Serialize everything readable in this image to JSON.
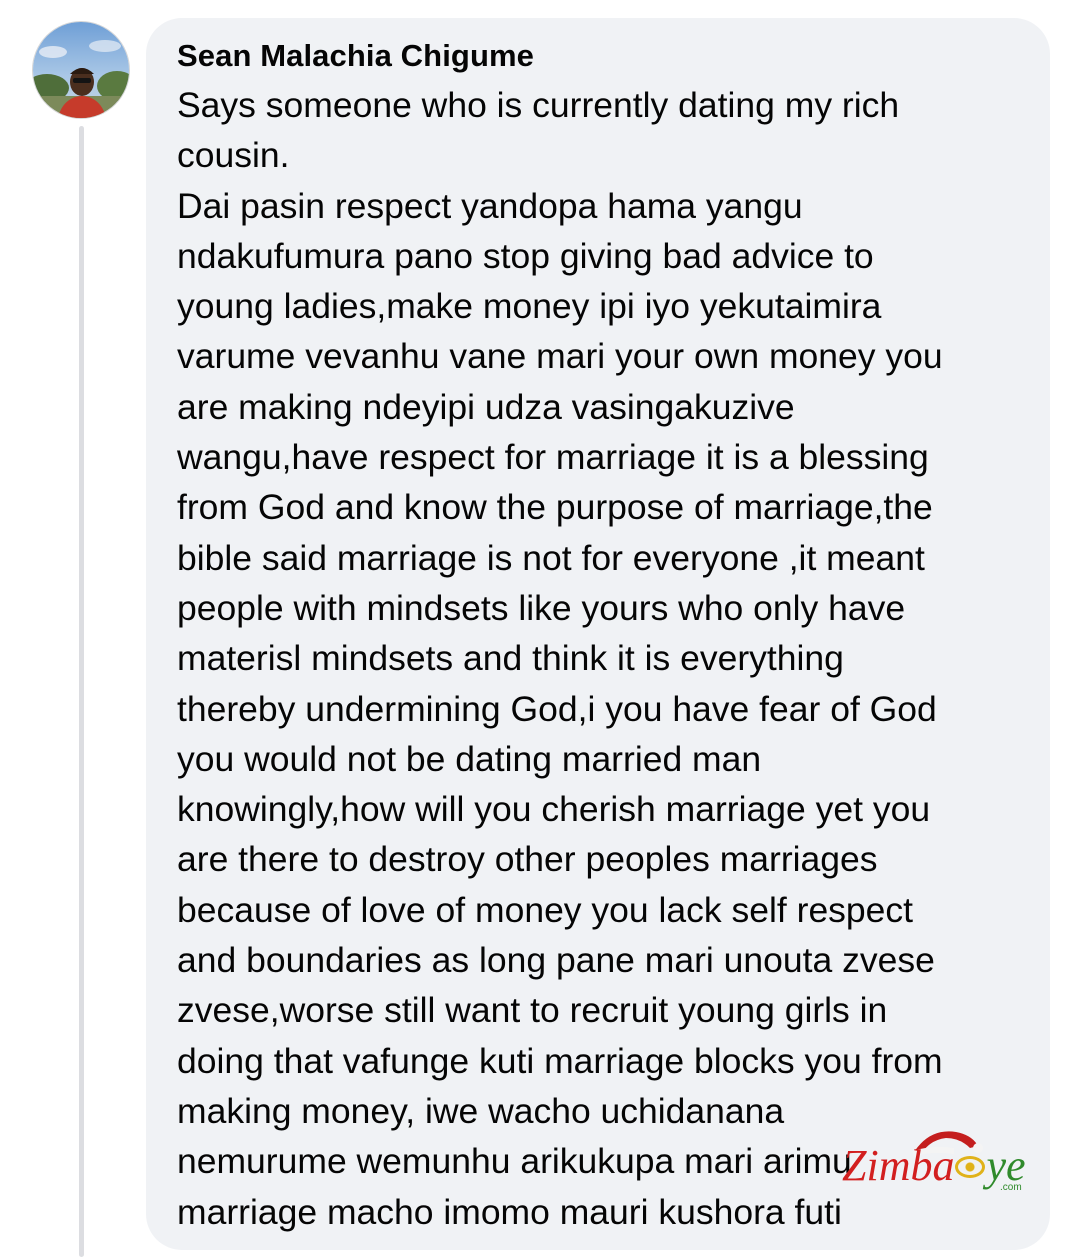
{
  "comment": {
    "author": "Sean Malachia Chigume",
    "lines": [
      "Says someone who is currently dating my rich",
      "cousin.",
      "Dai pasin respect yandopa hama yangu",
      "ndakufumura pano stop giving bad advice to",
      "young ladies,make money ipi iyo yekutaimira",
      "varume vevanhu vane mari your own money you",
      "are making ndeyipi udza vasingakuzive",
      "wangu,have respect for marriage it is a blessing",
      "from God and know the purpose of marriage,the",
      "bible said marriage is not for everyone ,it meant",
      "people with mindsets like yours who only have",
      "materisl mindsets and think it is everything",
      "thereby undermining God,i you have fear of God",
      "you would not be dating married man",
      "knowingly,how will you cherish marriage yet you",
      "are there to destroy other peoples marriages",
      "because of love of money you lack self respect",
      "and boundaries as long pane mari unouta zvese",
      "zvese,worse still want to recruit young girls in",
      "doing that vafunge kuti marriage blocks you from",
      "making money, iwe wacho uchidanana",
      "nemurume wemunhu arikukupa mari arimu",
      "marriage macho imomo mauri kushora futi"
    ]
  },
  "watermark": {
    "part1": "Zimba",
    "part2": "ye",
    "suffix": ".com",
    "hat_icon": "santa-hat-icon"
  },
  "colors": {
    "bubble": "#f0f2f5",
    "text": "#050505",
    "thread_line": "#dcdde1",
    "watermark_red": "#d21f1f",
    "watermark_green": "#2f8a2b",
    "watermark_gold": "#e0b21a"
  }
}
